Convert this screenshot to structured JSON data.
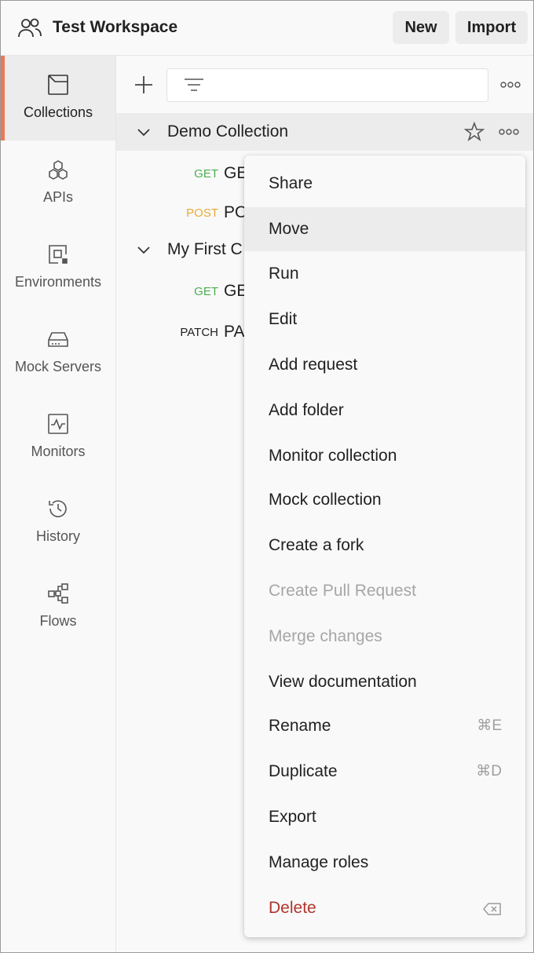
{
  "header": {
    "workspace_title": "Test Workspace",
    "new_label": "New",
    "import_label": "Import"
  },
  "sidebar": {
    "items": [
      {
        "label": "Collections",
        "icon": "collections-icon",
        "active": true
      },
      {
        "label": "APIs",
        "icon": "apis-icon"
      },
      {
        "label": "Environments",
        "icon": "environments-icon"
      },
      {
        "label": "Mock Servers",
        "icon": "mock-servers-icon"
      },
      {
        "label": "Monitors",
        "icon": "monitors-icon"
      },
      {
        "label": "History",
        "icon": "history-icon"
      },
      {
        "label": "Flows",
        "icon": "flows-icon"
      }
    ]
  },
  "tree": {
    "collections": [
      {
        "name": "Demo Collection",
        "requests": [
          {
            "method": "GET",
            "name": "GE",
            "method_color": "#4caf50"
          },
          {
            "method": "POST",
            "name": "PO",
            "method_color": "#e8a93a"
          }
        ]
      },
      {
        "name": "My First C",
        "requests": [
          {
            "method": "GET",
            "name": "GE",
            "method_color": "#4caf50"
          },
          {
            "method": "PATCH",
            "name": "PA",
            "method_color": "#212121"
          }
        ]
      }
    ]
  },
  "context_menu": {
    "items": [
      {
        "label": "Share"
      },
      {
        "label": "Move",
        "hover": true
      },
      {
        "label": "Run"
      },
      {
        "label": "Edit"
      },
      {
        "label": "Add request"
      },
      {
        "label": "Add folder"
      },
      {
        "label": "Monitor collection"
      },
      {
        "label": "Mock collection"
      },
      {
        "label": "Create a fork"
      },
      {
        "label": "Create Pull Request",
        "disabled": true
      },
      {
        "label": "Merge changes",
        "disabled": true
      },
      {
        "label": "View documentation"
      },
      {
        "label": "Rename",
        "shortcut": "⌘E"
      },
      {
        "label": "Duplicate",
        "shortcut": "⌘D"
      },
      {
        "label": "Export"
      },
      {
        "label": "Manage roles"
      },
      {
        "label": "Delete",
        "danger": true,
        "shortcut_icon": "backspace-icon"
      }
    ]
  }
}
